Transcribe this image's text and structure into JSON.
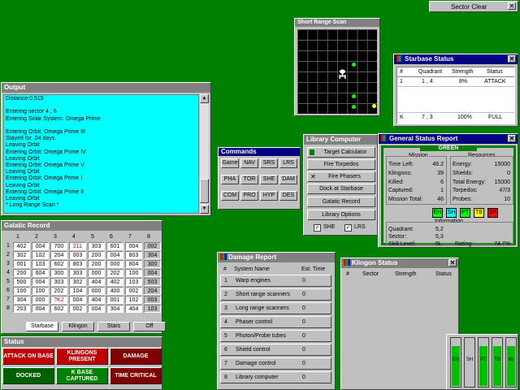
{
  "sector_clear": {
    "label": "Sector Clear"
  },
  "srs": {
    "title": "Short Range Scan"
  },
  "starbase_status": {
    "title": "Starbase Status",
    "headers": [
      "#",
      "Quadrant",
      "Strength",
      "Status"
    ],
    "rows": [
      {
        "num": "1",
        "quadrant": "1 , 4",
        "strength": "8%",
        "status": "ATTACK"
      },
      {
        "num": "K",
        "quadrant": "7 , 3",
        "strength": "100%",
        "status": "FULL"
      }
    ]
  },
  "output": {
    "title": "Output",
    "lines": [
      "Distance:0.515",
      "",
      "Entering sector 4 , 6",
      "Entering Solar System: Omega Prime",
      "",
      "Entering Orbit: Omega Prime III",
      "Stayed for .04 days.",
      "Leaving Orbit",
      "Entering Orbit: Omega Prime IV",
      "Leaving Orbit",
      "Entering Orbit: Omega Prime V",
      "Leaving Orbit",
      "Entering Orbit: Omega Prime I",
      "Leaving Orbit",
      "Entering Orbit: Omega Prime II",
      "Leaving Orbit",
      "* Long Range Scan *"
    ]
  },
  "commands": {
    "title": "Commands",
    "buttons": [
      "Game",
      "NAV",
      "SRS",
      "LRS",
      "PHA",
      "TOR",
      "SHE",
      "DAM",
      "COM",
      "PRO",
      "HYP",
      "DES"
    ]
  },
  "library": {
    "title": "Library Computer",
    "buttons": [
      "Target Calculator",
      "Fire Torpedos",
      "Fire Phasers",
      "Dock at Starbase",
      "Galatic Record",
      "Library Options"
    ],
    "she": "SHE",
    "lrs": "LRS"
  },
  "general": {
    "title": "General Status Report",
    "condition": "GREEN",
    "mission": {
      "title": "Mission",
      "time_left_label": "Time Left:",
      "time_left": "46.2",
      "klingons_label": "Klingons:",
      "klingons": "39",
      "killed_label": "Killed:",
      "killed": "6",
      "captured_label": "Captured:",
      "captured": "1",
      "mission_total_label": "Mission Total:",
      "mission_total": "46"
    },
    "resources": {
      "title": "Resources",
      "energy_label": "Energy:",
      "energy": "15000",
      "shields_label": "Shields:",
      "shields": "0",
      "total_energy_label": "Total Energy:",
      "total_energy": "15000",
      "torpedos_label": "Torpedos:",
      "torpedos": "47/3",
      "probes_label": "Probes:",
      "probes": "10"
    },
    "info": {
      "title": "Information",
      "quadrant_label": "Quadrant:",
      "quadrant": "5,2",
      "sector_label": "Sector:",
      "sector": "5,3",
      "skill_label": "Skill Level:",
      "skill": "6L",
      "rating_label": "Rating:",
      "rating": "74.7%"
    },
    "systems": [
      "EN",
      "SH",
      "PT",
      "TB",
      "SP"
    ]
  },
  "galatic": {
    "title": "Galatic Record",
    "cols": [
      "1",
      "2",
      "3",
      "4",
      "5",
      "6",
      "7",
      "8"
    ],
    "rows": [
      [
        "402",
        "004",
        "700",
        "211",
        "303",
        "601",
        "004",
        "002"
      ],
      [
        "302",
        "102",
        "204",
        "003",
        "200",
        "004",
        "803",
        "304"
      ],
      [
        "001",
        "103",
        "602",
        "803",
        "200",
        "000",
        "804",
        "300"
      ],
      [
        "200",
        "604",
        "300",
        "303",
        "000",
        "202",
        "100",
        "004"
      ],
      [
        "500",
        "004",
        "303",
        "302",
        "404",
        "402",
        "103",
        "503"
      ],
      [
        "100",
        "100",
        "202",
        "104",
        "000",
        "400",
        "002",
        "204"
      ],
      [
        "304",
        "000",
        "?K2",
        "004",
        "404",
        "001",
        "102",
        "003"
      ],
      [
        "203",
        "004",
        "602",
        "002",
        "004",
        "304",
        "404",
        "103"
      ]
    ],
    "tabs": [
      "Starbase",
      "Klingon",
      "Stars",
      "Off"
    ]
  },
  "status": {
    "title": "Status",
    "items": [
      "ATTACK ON BASE",
      "KLINGONS PRESENT",
      "DAMAGE",
      "DOCKED",
      "K BASE CAPTURED",
      "TIME CRITICAL"
    ],
    "colors": [
      "#c00000",
      "#c00000",
      "#800000",
      "#006000",
      "#008000",
      "#800000"
    ]
  },
  "damage": {
    "title": "Damage Report",
    "headers": [
      "#",
      "System Name",
      "Est. Time"
    ],
    "rows": [
      {
        "num": "1",
        "name": "Warp engines",
        "time": "0"
      },
      {
        "num": "2",
        "name": "Short range scanners",
        "time": "0"
      },
      {
        "num": "3",
        "name": "Long range scanners",
        "time": "0"
      },
      {
        "num": "4",
        "name": "Phaser control",
        "time": "0"
      },
      {
        "num": "5",
        "name": "Photon/Probe tubes",
        "time": "0"
      },
      {
        "num": "6",
        "name": "Shield control",
        "time": "0"
      },
      {
        "num": "7",
        "name": "Damage control",
        "time": "0"
      },
      {
        "num": "8",
        "name": "Library computer",
        "time": "0"
      }
    ]
  },
  "klingon": {
    "title": "Klingon Status",
    "headers": [
      "#",
      "Sector",
      "Strength",
      "Status"
    ]
  },
  "gauges": {
    "labels": [
      "EN",
      "SH",
      "PT",
      "TB",
      "MI"
    ],
    "levels": [
      0.85,
      0.0,
      0.85,
      0.85,
      0.85
    ]
  }
}
